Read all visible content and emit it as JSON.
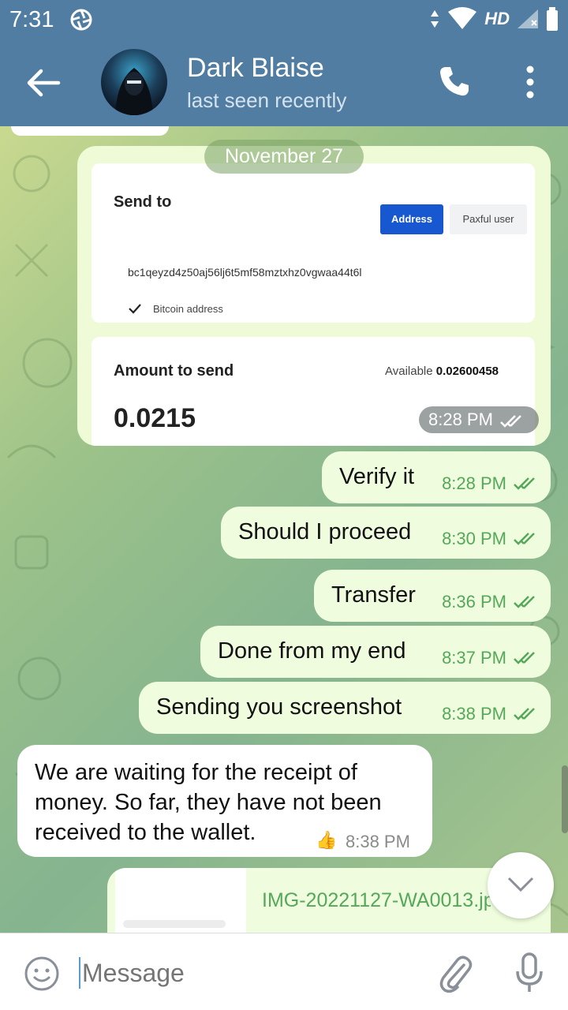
{
  "status_bar": {
    "time": "7:31",
    "network": "HD"
  },
  "header": {
    "contact_name": "Dark Blaise",
    "contact_status": "last seen recently"
  },
  "date_separator": "November 27",
  "media_message": {
    "send_to_label": "Send to",
    "address_button": "Address",
    "paxful_button": "Paxful user",
    "bitcoin_address": "bc1qeyzd4z50aj56lj6t5mf58mztxhz0vgwaa44t6l",
    "address_type": "Bitcoin address",
    "amount_label": "Amount to send",
    "available_label": "Available",
    "available_value": "0.02600458",
    "amount_value": "0.0215",
    "time": "8:28 PM"
  },
  "outgoing_messages": [
    {
      "text": "Verify it",
      "time": "8:28 PM"
    },
    {
      "text": "Should I proceed",
      "time": "8:30 PM"
    },
    {
      "text": "Transfer",
      "time": "8:36 PM"
    },
    {
      "text": "Done from my end",
      "time": "8:37 PM"
    },
    {
      "text": "Sending you screenshot",
      "time": "8:38 PM"
    }
  ],
  "incoming_message": {
    "text": "We are waiting for the receipt of money. So far, they have not been received to the wallet.",
    "reaction": "👍",
    "time": "8:38 PM"
  },
  "file_message": {
    "filename": "IMG-20221127-WA0013.jpg"
  },
  "composer": {
    "placeholder": "Message"
  },
  "colors": {
    "header": "#517da2",
    "outgoing_bubble": "#effdde",
    "time_green": "#55a85a"
  }
}
